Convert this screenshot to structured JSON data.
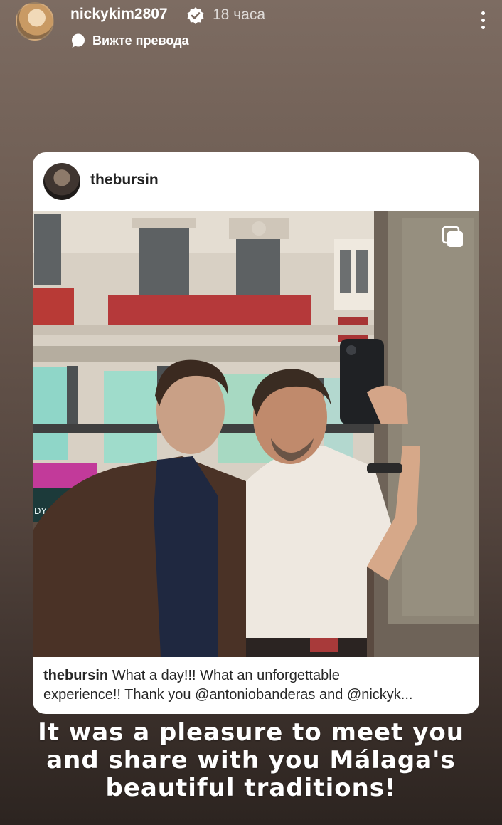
{
  "story_header": {
    "username": "nickykim2807",
    "time": "18 часа",
    "translate_label": "Вижте превода",
    "verified_icon": "verified-badge-icon",
    "more_icon": "more-options-icon"
  },
  "shared_post": {
    "username": "thebursin",
    "caption_user": "thebursin",
    "caption_line1": "What a day!!! What an unforgettable",
    "caption_line2": "experience!! Thank you @antoniobanderas and @nickyk...",
    "shop_sign": "DY SHOP",
    "multi_photo_icon": "carousel-icon"
  },
  "story_text": {
    "line1": "It was a pleasure to meet you",
    "line2": "and share with you Málaga's",
    "line3": "beautiful traditions!"
  },
  "colors": {
    "background_top": "#7d6c62",
    "background_bottom": "#2c2420",
    "card": "#ffffff"
  }
}
